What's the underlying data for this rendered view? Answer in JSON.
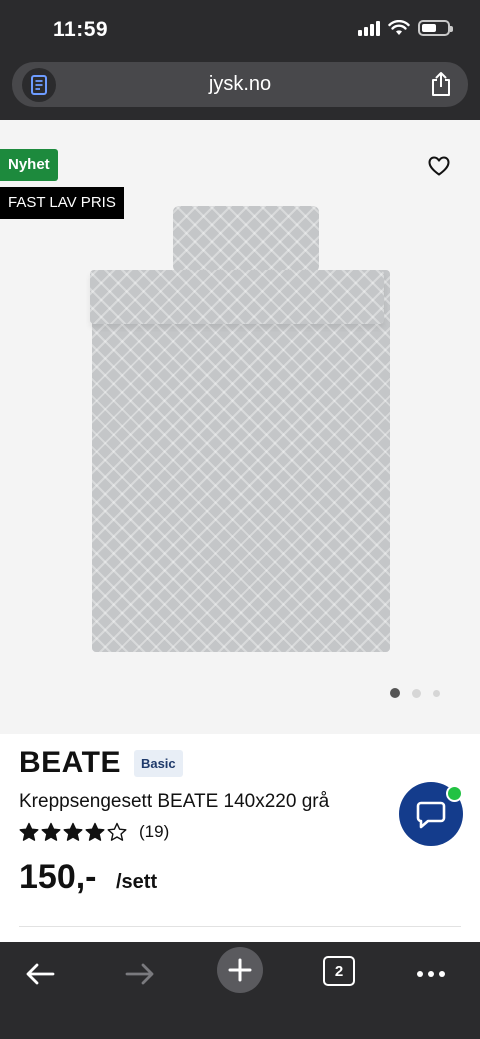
{
  "status_bar": {
    "time": "11:59"
  },
  "browser": {
    "url": "jysk.no",
    "open_tabs": "2"
  },
  "product": {
    "badges": {
      "new": "Nyhet",
      "price": "FAST LAV PRIS"
    },
    "image_count": 3,
    "active_image": 1,
    "brand": "BEATE",
    "tag": "Basic",
    "name": "Kreppsengesett BEATE 140x220 grå",
    "rating_value": 4,
    "rating_max": 5,
    "rating_count": "(19)",
    "price": "150,-",
    "unit": "/sett"
  },
  "icons": {
    "reader": "reader-icon",
    "share": "share-icon",
    "favorite": "heart-icon",
    "chat": "chat-bubble-icon",
    "back": "arrow-left-icon",
    "forward": "arrow-right-icon",
    "new_tab": "plus-icon",
    "more": "more-dots-icon"
  },
  "colors": {
    "badge_new": "#1d8a3d",
    "badge_price": "#000000",
    "chat_fab": "#143c8c",
    "chat_online": "#22c243"
  }
}
